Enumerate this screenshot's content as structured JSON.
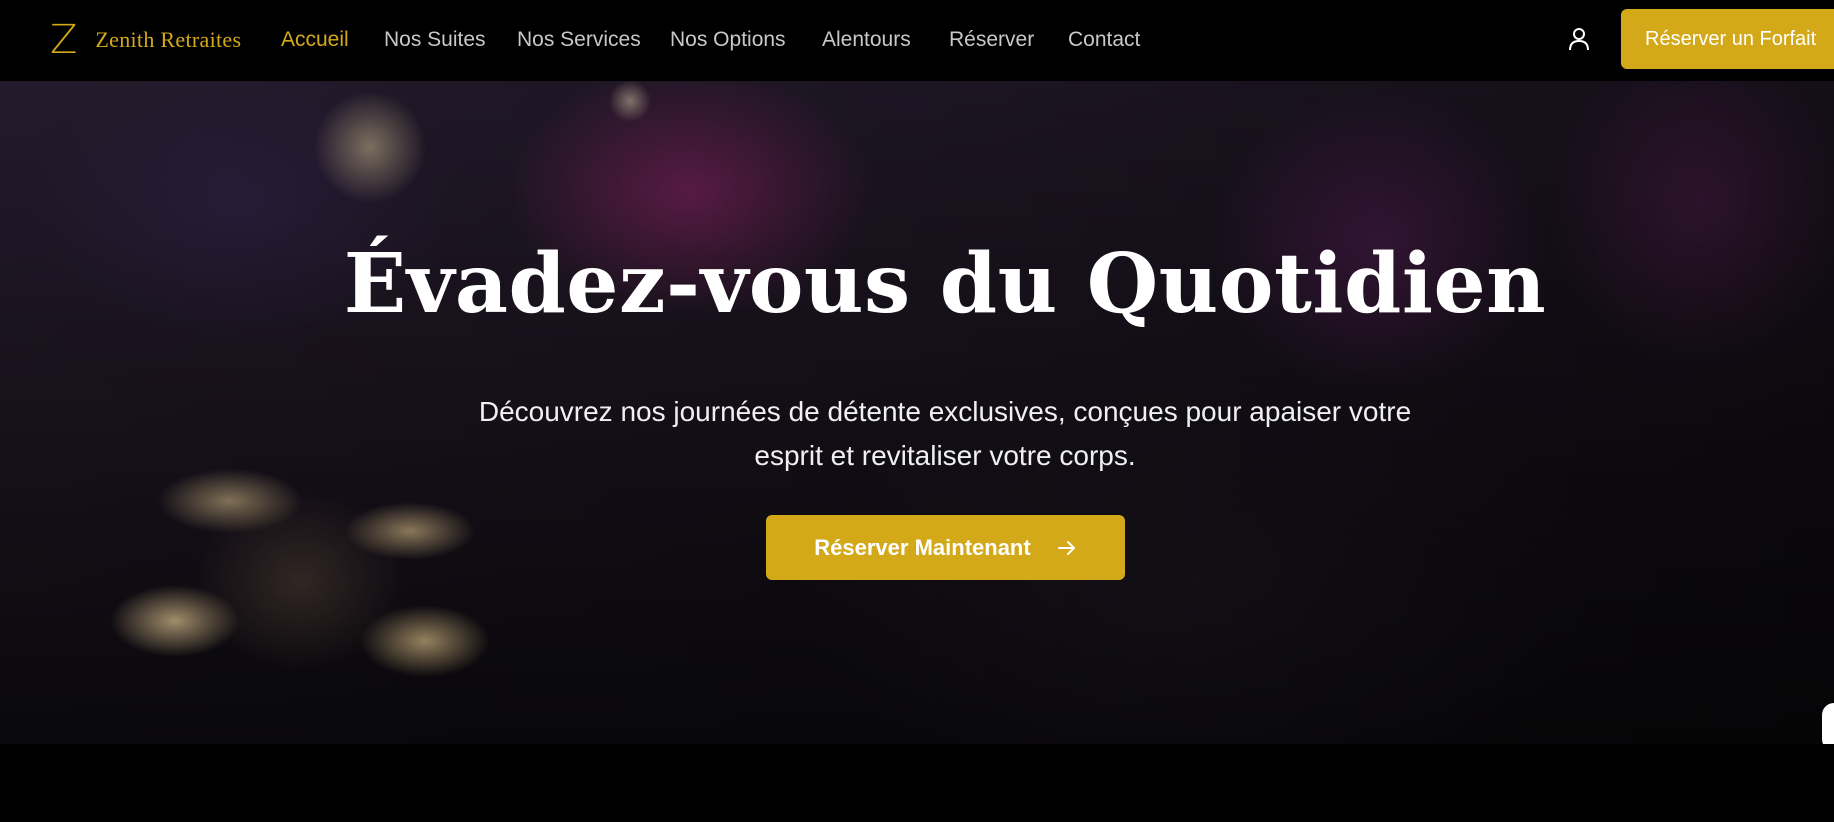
{
  "brand": {
    "logo_letter": "Z",
    "name": "Zenith Retraites",
    "color": "#d4a919"
  },
  "nav": {
    "items": [
      {
        "label": "Accueil",
        "active": true
      },
      {
        "label": "Nos Suites",
        "active": false
      },
      {
        "label": "Nos Services",
        "active": false
      },
      {
        "label": "Nos Options",
        "active": false
      },
      {
        "label": "Alentours",
        "active": false
      },
      {
        "label": "Réserver",
        "active": false
      },
      {
        "label": "Contact",
        "active": false
      }
    ],
    "user_icon": "user-icon",
    "cta_label": "Réserver un Forfait"
  },
  "hero": {
    "title": "Évadez-vous du Quotidien",
    "subtitle_line1": "Découvrez nos journées de détente exclusives, conçues pour apaiser votre",
    "subtitle_line2": "esprit et revitaliser votre corps.",
    "cta_label": "Réserver Maintenant",
    "cta_icon": "arrow-right-icon"
  },
  "colors": {
    "accent": "#d4a919",
    "background": "#000000",
    "nav_text": "#c8c8c8"
  }
}
